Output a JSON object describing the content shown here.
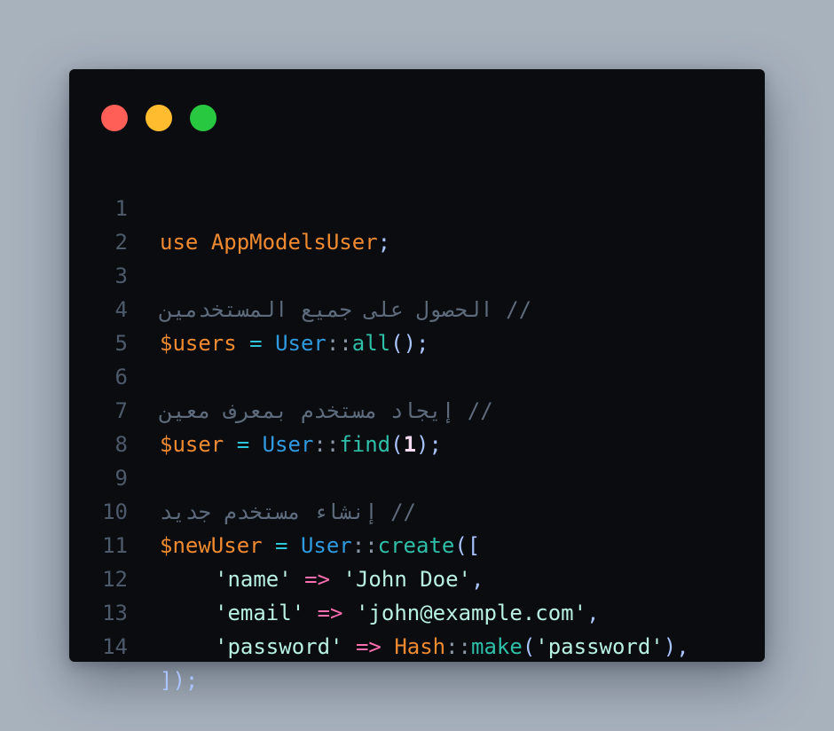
{
  "window": {
    "controls": [
      "close",
      "minimize",
      "maximize"
    ],
    "colors": {
      "close": "#ff5f57",
      "minimize": "#febc2e",
      "maximize": "#28c840",
      "background": "#0a0c10",
      "page": "#a8b2bd"
    }
  },
  "code": {
    "line_numbers": [
      "1",
      "2",
      "3",
      "4",
      "5",
      "6",
      "7",
      "8",
      "9",
      "10",
      "11",
      "12",
      "13",
      "14"
    ],
    "l1": {
      "kw": "use",
      "ns": "AppModelsUser",
      "semi": ";"
    },
    "l3": {
      "comment": "// الحصول على جميع المستخدمين"
    },
    "l4": {
      "var": "$users",
      "eq": "=",
      "cls": "User",
      "sep": "::",
      "fn": "all",
      "tail": "();"
    },
    "l6": {
      "comment": "// إيجاد مستخدم بمعرف معين"
    },
    "l7": {
      "var": "$user",
      "eq": "=",
      "cls": "User",
      "sep": "::",
      "fn": "find",
      "open": "(",
      "num": "1",
      "close": ");"
    },
    "l9": {
      "comment": "// إنشاء مستخدم جديد"
    },
    "l10": {
      "var": "$newUser",
      "eq": "=",
      "cls": "User",
      "sep": "::",
      "fn": "create",
      "open": "(["
    },
    "l11": {
      "key": "'name'",
      "arrow": "=>",
      "val": "'John Doe'",
      "comma": ","
    },
    "l12": {
      "key": "'email'",
      "arrow": "=>",
      "val": "'john@example.com'",
      "comma": ","
    },
    "l13": {
      "key": "'password'",
      "arrow": "=>",
      "cls": "Hash",
      "sep": "::",
      "fn": "make",
      "open": "(",
      "val": "'password'",
      "close": "),",
      "comma": ""
    },
    "l14": {
      "close": "]);"
    }
  }
}
